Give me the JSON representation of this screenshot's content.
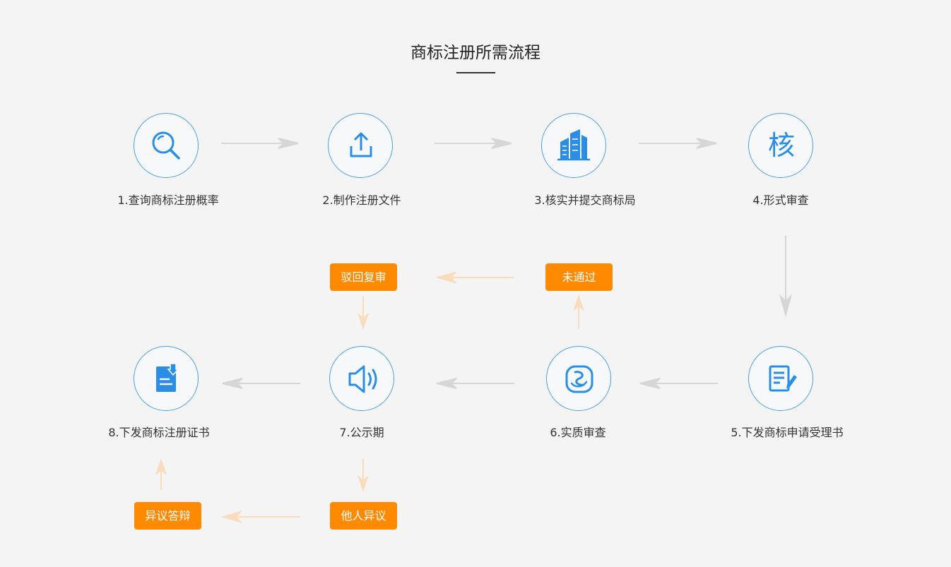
{
  "title": "商标注册所需流程",
  "steps": [
    {
      "label": "1.查询商标注册概率",
      "icon": "search-icon"
    },
    {
      "label": "2.制作注册文件",
      "icon": "upload-icon"
    },
    {
      "label": "3.核实并提交商标局",
      "icon": "building-icon"
    },
    {
      "label": "4.形式审查",
      "icon": "review-icon",
      "glyph": "核"
    },
    {
      "label": "5.下发商标申请受理书",
      "icon": "document-edit-icon"
    },
    {
      "label": "6.实质审查",
      "icon": "inspection-icon"
    },
    {
      "label": "7.公示期",
      "icon": "speaker-icon"
    },
    {
      "label": "8.下发商标注册证书",
      "icon": "certificate-icon"
    }
  ],
  "tags": {
    "rejected": "未通过",
    "reexamine": "驳回复审",
    "objection": "他人异议",
    "defense": "异议答辩"
  },
  "colors": {
    "accent": "#4a9fe8",
    "icon": "#2a8ee6",
    "tag": "#ff8a00",
    "arrow": "#d6d6d6",
    "arrow_light": "#f8dcbc"
  }
}
